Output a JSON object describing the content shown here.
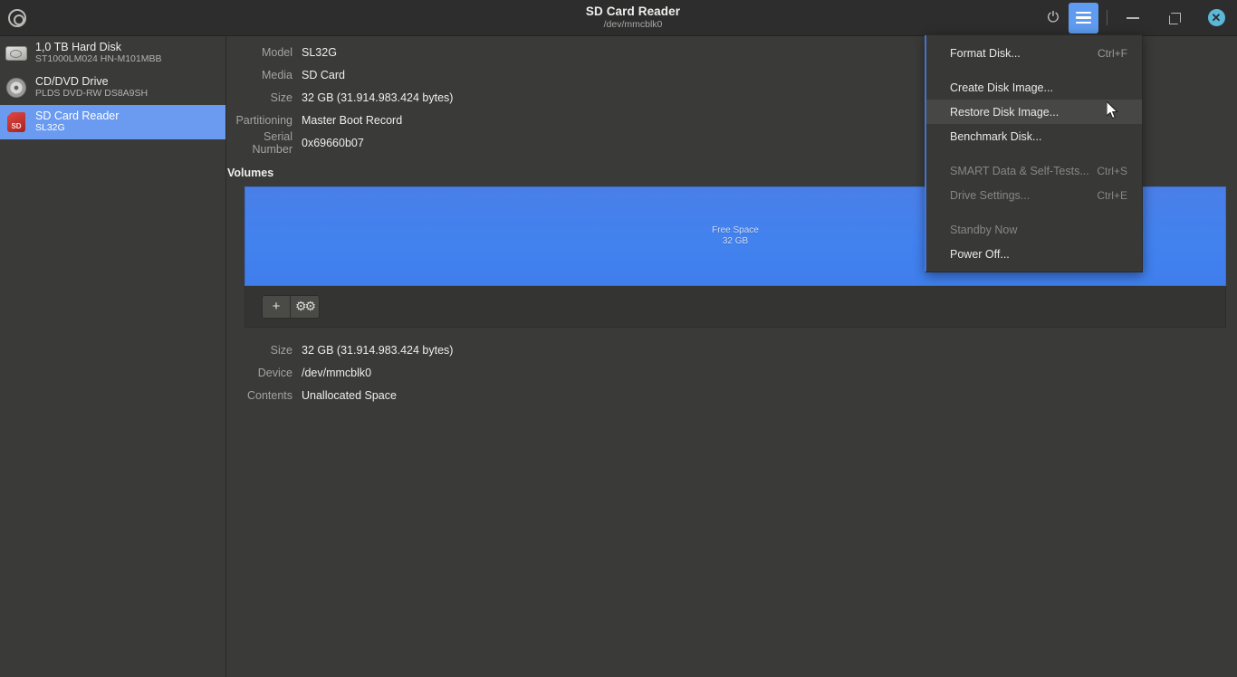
{
  "titlebar": {
    "app_icon": "disk-icon",
    "title": "SD Card Reader",
    "subtitle": "/dev/mmcblk0",
    "power_icon": "power-icon",
    "menu_icon": "hamburger-menu-icon",
    "minimize_icon": "minimize-icon",
    "maximize_icon": "maximize-icon",
    "close_icon": "close-icon"
  },
  "sidebar": {
    "devices": [
      {
        "icon": "hard-disk-icon",
        "name": "1,0 TB Hard Disk",
        "sub": "ST1000LM024 HN-M101MBB",
        "selected": false
      },
      {
        "icon": "cd-dvd-icon",
        "name": "CD/DVD Drive",
        "sub": "PLDS DVD-RW DS8A9SH",
        "selected": false
      },
      {
        "icon": "sd-card-icon",
        "name": "SD Card Reader",
        "sub": "SL32G",
        "selected": true
      }
    ]
  },
  "drive_info": [
    {
      "label": "Model",
      "value": "SL32G"
    },
    {
      "label": "Media",
      "value": "SD Card"
    },
    {
      "label": "Size",
      "value": "32 GB (31.914.983.424 bytes)"
    },
    {
      "label": "Partitioning",
      "value": "Master Boot Record"
    },
    {
      "label": "Serial Number",
      "value": "0x69660b07"
    }
  ],
  "volumes": {
    "heading": "Volumes",
    "segment": {
      "title": "Free Space",
      "size": "32 GB",
      "color": "#4280ee"
    },
    "toolbar": {
      "add_label": "+",
      "add_icon": "plus-icon",
      "settings_icon": "gears-icon",
      "settings_label": "⚙"
    }
  },
  "volume_details": [
    {
      "label": "Size",
      "value": "32 GB (31.914.983.424 bytes)"
    },
    {
      "label": "Device",
      "value": "/dev/mmcblk0"
    },
    {
      "label": "Contents",
      "value": "Unallocated Space"
    }
  ],
  "menu": {
    "items": [
      {
        "label": "Format Disk...",
        "accel": "Ctrl+F",
        "disabled": false,
        "hover": false,
        "gap_after": true
      },
      {
        "label": "Create Disk Image...",
        "accel": "",
        "disabled": false,
        "hover": false,
        "gap_after": false
      },
      {
        "label": "Restore Disk Image...",
        "accel": "",
        "disabled": false,
        "hover": true,
        "gap_after": false
      },
      {
        "label": "Benchmark Disk...",
        "accel": "",
        "disabled": false,
        "hover": false,
        "gap_after": true
      },
      {
        "label": "SMART Data & Self-Tests...",
        "accel": "Ctrl+S",
        "disabled": true,
        "hover": false,
        "gap_after": false
      },
      {
        "label": "Drive Settings...",
        "accel": "Ctrl+E",
        "disabled": true,
        "hover": false,
        "gap_after": true
      },
      {
        "label": "Standby Now",
        "accel": "",
        "disabled": true,
        "hover": false,
        "gap_after": false
      },
      {
        "label": "Power Off...",
        "accel": "",
        "disabled": false,
        "hover": false,
        "gap_after": false
      }
    ]
  },
  "colors": {
    "accent": "#4280ee",
    "selection": "#6a9bf0",
    "window_bg": "#3a3a38",
    "titlebar_bg": "#2d2d2d",
    "close_button": "#5bb8d8"
  },
  "cursor": {
    "name": "mouse-pointer"
  }
}
